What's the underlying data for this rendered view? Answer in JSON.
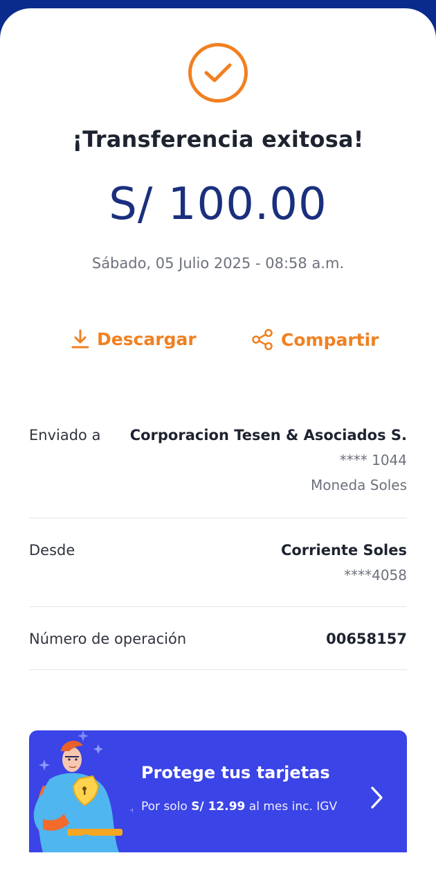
{
  "status": {
    "title": "¡Transferencia exitosa!",
    "amount": "S/ 100.00",
    "datetime": "Sábado, 05 Julio 2025 - 08:58 a.m."
  },
  "actions": {
    "download_label": "Descargar",
    "share_label": "Compartir"
  },
  "details": {
    "sent_to": {
      "label": "Enviado a",
      "name": "Corporacion Tesen & Asociados S.",
      "account": "**** 1044",
      "currency": "Moneda Soles"
    },
    "from": {
      "label": "Desde",
      "account_name": "Corriente Soles",
      "account": "****4058"
    },
    "operation": {
      "label": "Número de operación",
      "number": "00658157"
    }
  },
  "promo": {
    "title": "Protege tus tarjetas",
    "desc_prefix": "Por solo ",
    "price": "S/ 12.99",
    "desc_suffix": " al mes inc. IGV"
  },
  "colors": {
    "accent": "#f08021",
    "amount": "#1a2f7d",
    "header_bg": "#0a2a8c",
    "promo_bg": "#3b44e6"
  },
  "icons": {
    "status": "check-circle-icon",
    "download": "download-icon",
    "share": "share-icon",
    "promo_arrow": "chevron-right-icon",
    "promo_art": "superhero-illustration"
  }
}
